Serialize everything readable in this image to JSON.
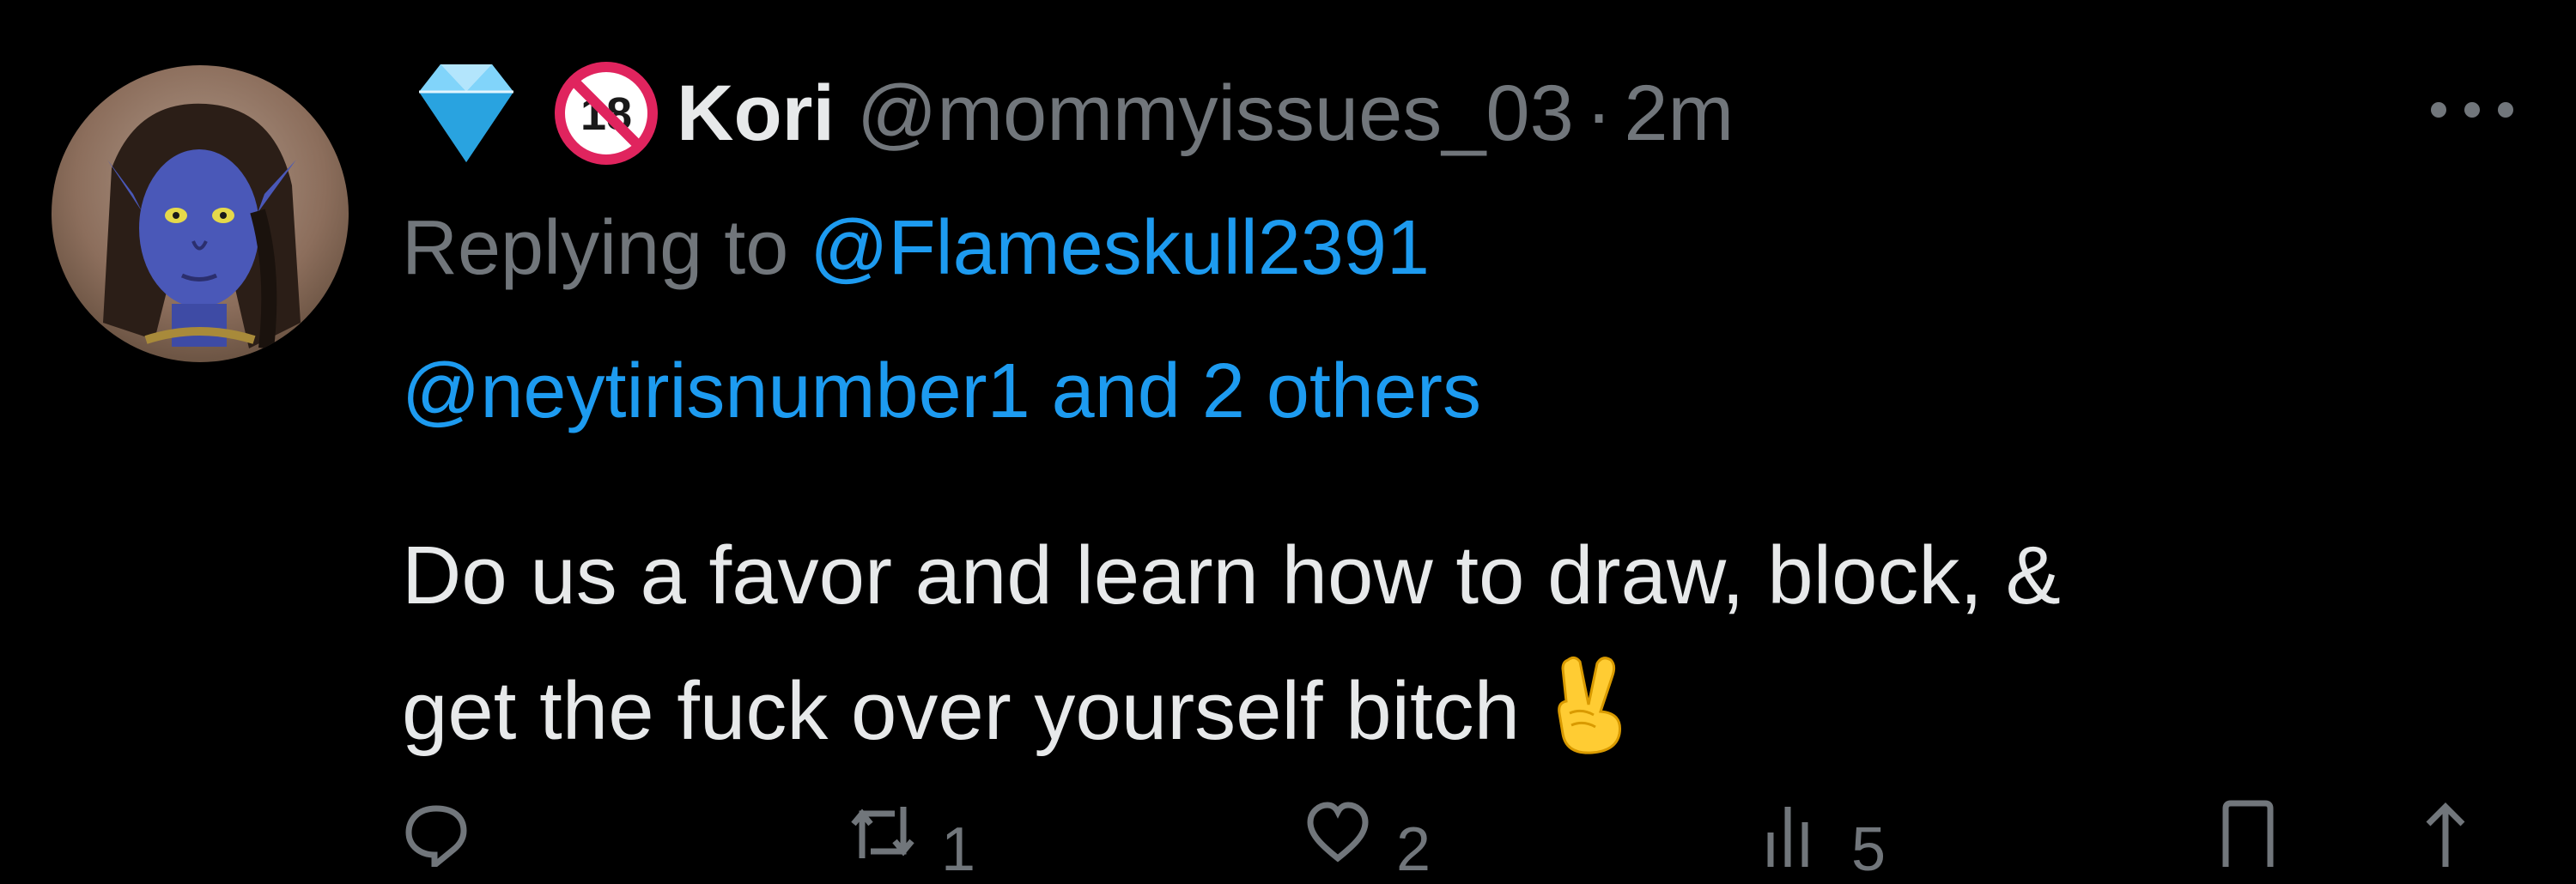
{
  "tweet": {
    "display_name": "Kori",
    "handle": "@mommyissues_03",
    "separator": "·",
    "time": "2m",
    "badges": [
      "diamond-icon",
      "no-under-18-icon"
    ],
    "replying": {
      "prefix": "Replying to",
      "mention_1": "@Flameskull2391",
      "mention_2": "@neytirisnumber1 and 2 others"
    },
    "text_line_1": "Do us a favor and learn how to draw, block, &",
    "text_line_2": "get the fuck over yourself bitch",
    "text_emoji": "victory-hand-icon"
  },
  "actions": {
    "reply": {
      "icon": "reply-icon",
      "count": ""
    },
    "retweet": {
      "icon": "retweet-icon",
      "count": "1"
    },
    "like": {
      "icon": "heart-icon",
      "count": "2"
    },
    "views": {
      "icon": "views-icon",
      "count": "5"
    },
    "bookmark": {
      "icon": "bookmark-icon",
      "count": ""
    },
    "share": {
      "icon": "share-icon",
      "count": ""
    }
  },
  "colors": {
    "background": "#000000",
    "primary_text": "#e7e9ea",
    "secondary_text": "#71767b",
    "link": "#1d9bf0",
    "diamond": "#4fc3f7",
    "prohibited": "#e0245e"
  }
}
